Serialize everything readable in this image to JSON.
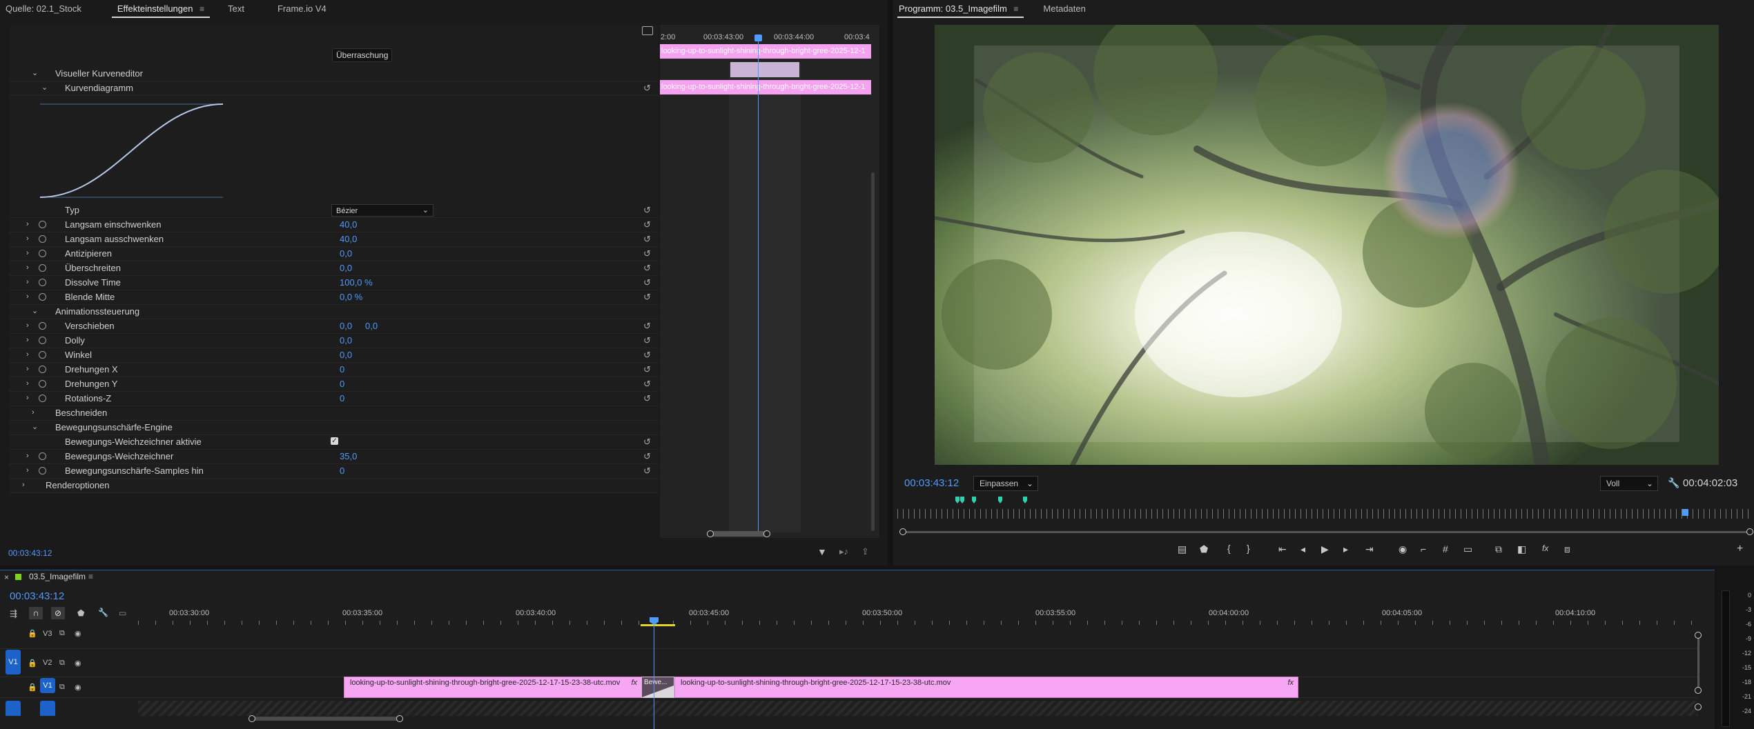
{
  "source_tabs": [
    {
      "label": "Quelle: 02.1_Stock",
      "active": false
    },
    {
      "label": "Effekteinstellungen",
      "active": true
    },
    {
      "label": "Text",
      "active": false
    },
    {
      "label": "Frame.io V4",
      "active": false
    }
  ],
  "effects": {
    "effect_name_badge": "Überraschung",
    "visual_curve_editor": "Visueller Kurveneditor",
    "curve_diagram": "Kurvendiagramm",
    "type_label": "Typ",
    "type_value": "Bézier",
    "params": [
      {
        "label": "Langsam einschwenken",
        "value": "40,0"
      },
      {
        "label": "Langsam ausschwenken",
        "value": "40,0"
      },
      {
        "label": "Antizipieren",
        "value": "0,0"
      },
      {
        "label": "Überschreiten",
        "value": "0,0"
      },
      {
        "label": "Dissolve Time",
        "value": "100,0 %"
      },
      {
        "label": "Blende Mitte",
        "value": "0,0 %"
      }
    ],
    "animation_group": "Animationssteuerung",
    "anim_params": [
      {
        "label": "Verschieben",
        "value": "0,0",
        "value2": "0,0"
      },
      {
        "label": "Dolly",
        "value": "0,0"
      },
      {
        "label": "Winkel",
        "value": "0,0"
      },
      {
        "label": "Drehungen X",
        "value": "0"
      },
      {
        "label": "Drehungen Y",
        "value": "0"
      },
      {
        "label": "Rotations-Z",
        "value": "0"
      }
    ],
    "crop_group": "Beschneiden",
    "motion_blur_group": "Bewegungsunschärfe-Engine",
    "motion_blur_enabled_label": "Bewegungs-Weichzeichner aktivie",
    "motion_blur_enabled": true,
    "motion_blur_params": [
      {
        "label": "Bewegungs-Weichzeichner",
        "value": "35,0"
      },
      {
        "label": "Bewegungsunschärfe-Samples hin",
        "value": "0"
      }
    ],
    "render_options": "Renderoptionen",
    "timecode": "00:03:43:12"
  },
  "mini_timeline": {
    "ruler": [
      "2:00",
      "00:03:43:00",
      "00:03:44:00",
      "00:03:4"
    ],
    "clip_label": "looking-up-to-sunlight-shining-through-bright-gree-2025-12-1"
  },
  "program_tabs": [
    {
      "label": "Programm: 03.5_Imagefilm",
      "active": true
    },
    {
      "label": "Metadaten",
      "active": false
    }
  ],
  "program": {
    "timecode": "00:03:43:12",
    "fit": "Einpassen",
    "quality": "Voll",
    "duration": "00:04:02:03"
  },
  "sequence": {
    "name": "03.5_Imagefilm",
    "timecode": "00:03:43:12",
    "ruler": [
      "00:03:30:00",
      "00:03:35:00",
      "00:03:40:00",
      "00:03:45:00",
      "00:03:50:00",
      "00:03:55:00",
      "00:04:00:00",
      "00:04:05:00",
      "00:04:10:00"
    ],
    "tracks": [
      "V3",
      "V2",
      "V1"
    ],
    "source_patch": "V1",
    "clip_a": "looking-up-to-sunlight-shining-through-bright-gree-2025-12-17-15-23-38-utc.mov",
    "transition": "Bewe...",
    "clip_b": "looking-up-to-sunlight-shining-through-bright-gree-2025-12-17-15-23-38-utc.mov",
    "fx": "fx"
  },
  "meter_ticks": [
    "0",
    "-3",
    "-6",
    "-9",
    "-12",
    "-15",
    "-18",
    "-21",
    "-24"
  ],
  "colors": {
    "accent": "#4f9bff",
    "clip": "#f7a6f3",
    "marker": "#2fd1b0",
    "sequence_tag": "#7ed321"
  }
}
